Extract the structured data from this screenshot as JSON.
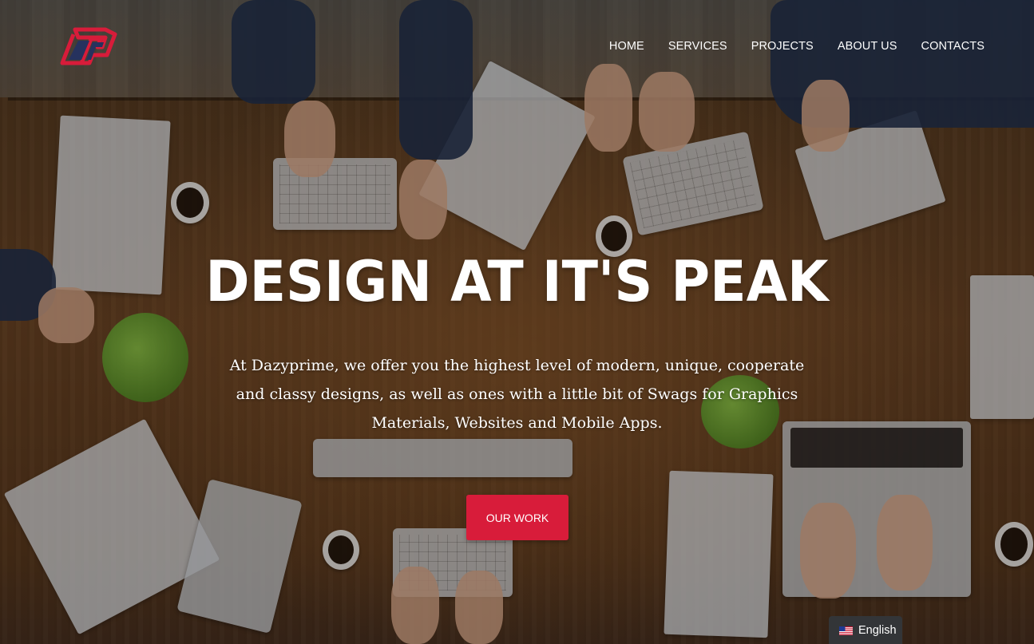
{
  "brand": {
    "logo_text": "dp",
    "colors": {
      "red": "#d81c3a",
      "navy": "#26325e"
    }
  },
  "nav": {
    "items": [
      {
        "label": "HOME"
      },
      {
        "label": "SERVICES"
      },
      {
        "label": "PROJECTS"
      },
      {
        "label": "ABOUT US"
      },
      {
        "label": "CONTACTS"
      }
    ]
  },
  "hero": {
    "title": "DESIGN AT IT'S PEAK",
    "subtitle": "At Dazyprime, we offer you the highest level of modern, unique, cooperate and classy designs, as well as ones with a little bit of Swags for Graphics Materials, Websites and Mobile Apps.",
    "cta_label": "OUR WORK",
    "cta_color": "#d81c3a"
  },
  "language": {
    "label": "English",
    "flag_icon": "us-flag-icon"
  }
}
